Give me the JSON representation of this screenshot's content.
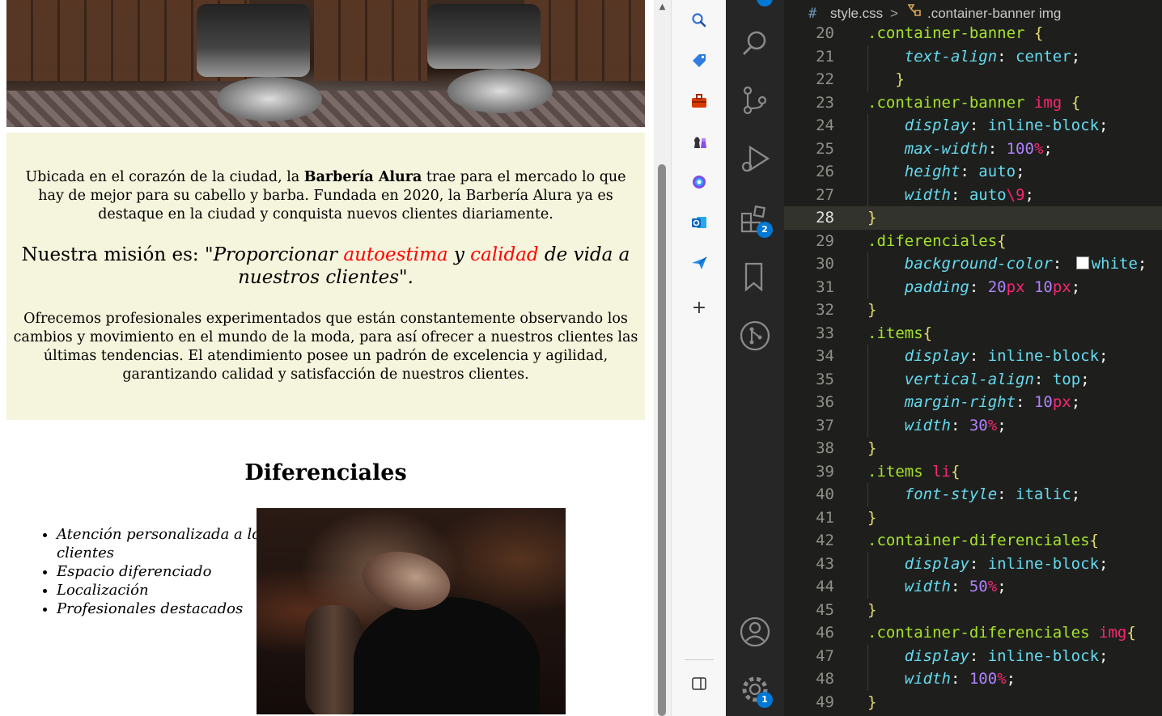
{
  "page": {
    "intro_before": "Ubicada en el corazón de la ciudad, la ",
    "intro_bold": "Barbería Alura",
    "intro_after": " trae para el mercado lo que hay de mejor para su cabello y barba. Fundada en 2020, la Barbería Alura ya es destaque en la ciudad y conquista nuevos clientes diariamente.",
    "mision_prefix": "Nuestra misión es: ",
    "mision_q1": "\"Proporcionar ",
    "mision_red1": "autoestima",
    "mision_mid": " y ",
    "mision_red2": "calidad",
    "mision_end": " de vida a nuestros clientes\".",
    "ofrecemos": "Ofrecemos profesionales experimentados que están constantemente observando los cambios y movimiento en el mundo de la moda, para así ofrecer a nuestros clientes las últimas tendencias. El atendimiento posee un padrón de excelencia y agilidad, garantizando calidad y satisfacción de nuestros clientes.",
    "diferenciales_title": "Diferenciales",
    "items": [
      "Atención personalizada a los clientes",
      "Espacio diferenciado",
      "Localización",
      "Profesionales destacados"
    ]
  },
  "editor": {
    "breadcrumb": {
      "hash": "#",
      "file": "style.css",
      "separator": ">",
      "symbol": ".container-banner img"
    },
    "badges": {
      "extensions": "2",
      "settings": "1"
    },
    "current_line": 28,
    "swatch_color": "#ffffff"
  }
}
